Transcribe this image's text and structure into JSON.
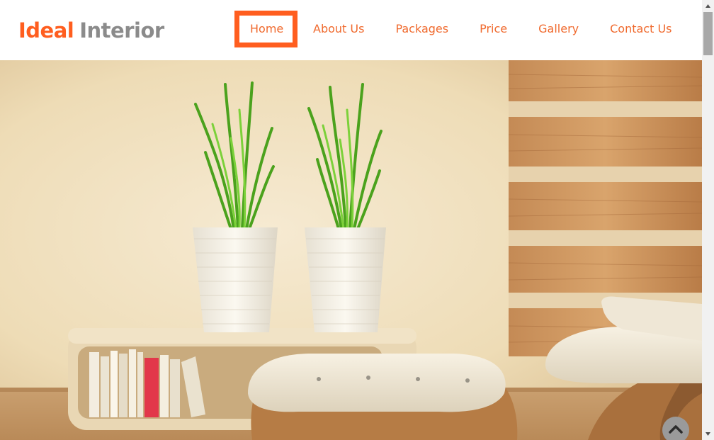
{
  "brand": {
    "part1": "Ideal",
    "part2": "Interior"
  },
  "nav": {
    "home": "Home",
    "about": "About Us",
    "packages": "Packages",
    "price": "Price",
    "gallery": "Gallery",
    "contact": "Contact Us",
    "active": "home"
  },
  "colors": {
    "accent": "#ff5e1f",
    "nav_text": "#f06a2e",
    "logo_gray": "#8b8b8b"
  },
  "hero": {
    "icon": "living-room-photo"
  },
  "controls": {
    "back_to_top_icon": "chevron-up-icon"
  }
}
